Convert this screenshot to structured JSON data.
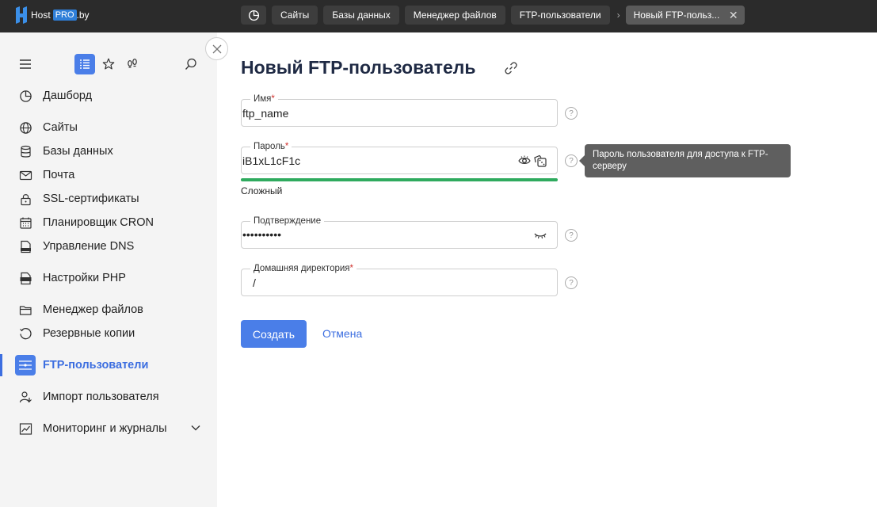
{
  "logo": {
    "host": "Host",
    "pro": "PRO",
    "by": ".by"
  },
  "tabs": [
    {
      "label": "Сайты"
    },
    {
      "label": "Базы данных"
    },
    {
      "label": "Менеджер файлов"
    },
    {
      "label": "FTP-пользователи"
    }
  ],
  "active_tab": {
    "label": "Новый FTP-польз..."
  },
  "sidebar": {
    "items": [
      {
        "label": "Дашборд",
        "icon": "dashboard-icon"
      },
      {
        "label": "Сайты",
        "icon": "globe-icon"
      },
      {
        "label": "Базы данных",
        "icon": "database-icon"
      },
      {
        "label": "Почта",
        "icon": "mail-icon"
      },
      {
        "label": "SSL-сертификаты",
        "icon": "lock-icon"
      },
      {
        "label": "Планировщик CRON",
        "icon": "calendar-icon"
      },
      {
        "label": "Управление DNS",
        "icon": "dns-icon"
      },
      {
        "label": "Настройки PHP",
        "icon": "php-icon"
      },
      {
        "label": "Менеджер файлов",
        "icon": "folder-icon"
      },
      {
        "label": "Резервные копии",
        "icon": "backup-icon"
      },
      {
        "label": "FTP-пользователи",
        "icon": "ftp-icon",
        "active": true
      },
      {
        "label": "Импорт пользователя",
        "icon": "user-import-icon"
      },
      {
        "label": "Мониторинг и журналы",
        "icon": "monitoring-icon"
      }
    ]
  },
  "form": {
    "title": "Новый FTP-пользователь",
    "name": {
      "label": "Имя",
      "required": "*",
      "value": "ftp_name"
    },
    "password": {
      "label": "Пароль",
      "required": "*",
      "value": "iB1xL1cF1c"
    },
    "strength": {
      "label": "Сложный",
      "level": 1.0,
      "color": "#2faa5e"
    },
    "confirm": {
      "label": "Подтверждение",
      "value": "••••••••••"
    },
    "home": {
      "label": "Домашняя директория",
      "required": "*",
      "value": "/"
    },
    "help_glyph": "?",
    "tooltip": "Пароль пользователя для доступа к FTP-серверу",
    "create_label": "Создать",
    "cancel_label": "Отмена"
  },
  "colors": {
    "accent": "#4a7ee8",
    "topbar": "#2b2b2b",
    "sidebar": "#f4f4f4"
  }
}
